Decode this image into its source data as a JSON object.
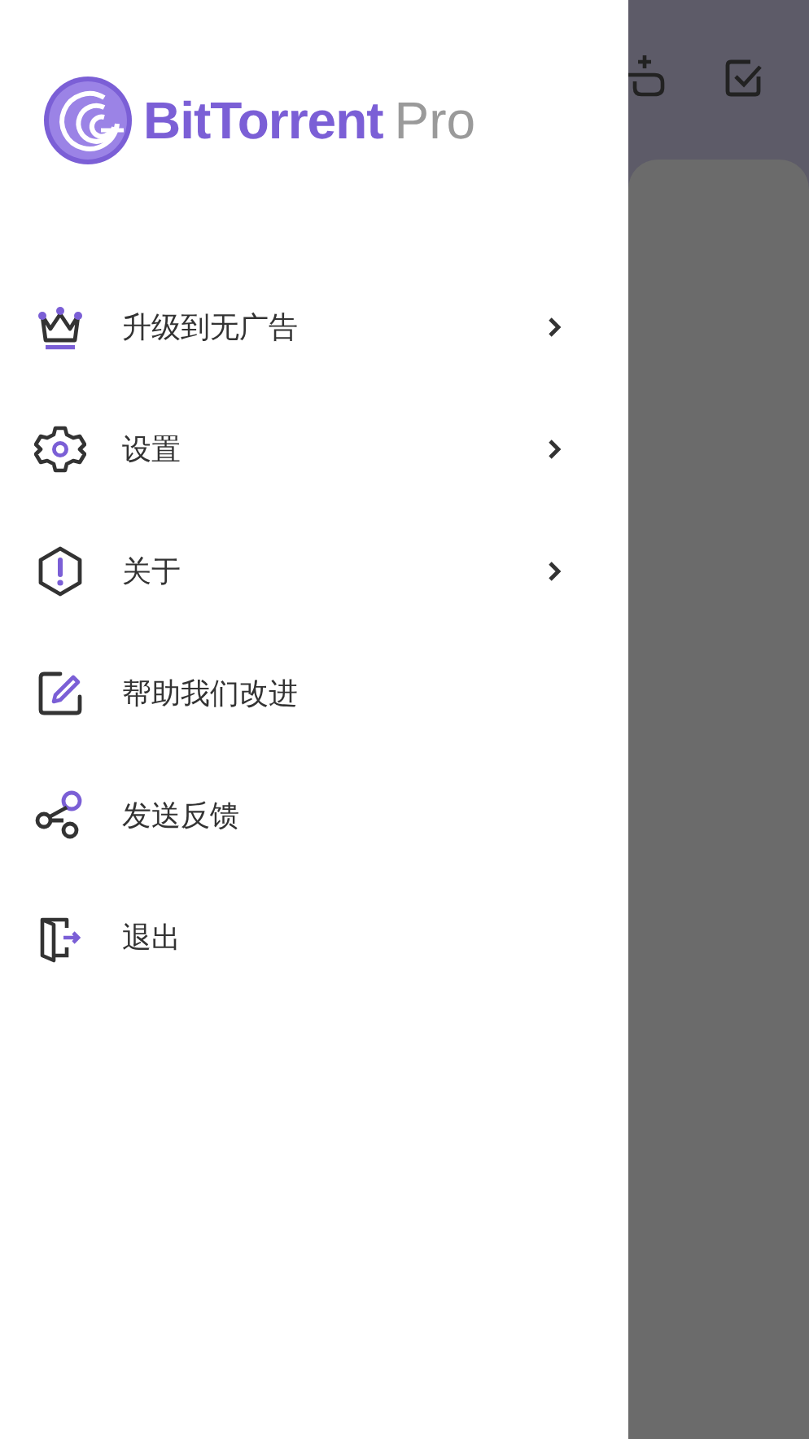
{
  "logo": {
    "name": "BitTorrent",
    "suffix": "Pro"
  },
  "menu": [
    {
      "label": "升级到无广告",
      "kind": "crown",
      "chevron": true
    },
    {
      "label": "设置",
      "kind": "gear",
      "chevron": true
    },
    {
      "label": "关于",
      "kind": "info",
      "chevron": true
    },
    {
      "label": "帮助我们改进",
      "kind": "edit",
      "chevron": false
    },
    {
      "label": "发送反馈",
      "kind": "share",
      "chevron": false
    },
    {
      "label": "退出",
      "kind": "exit",
      "chevron": false
    }
  ]
}
